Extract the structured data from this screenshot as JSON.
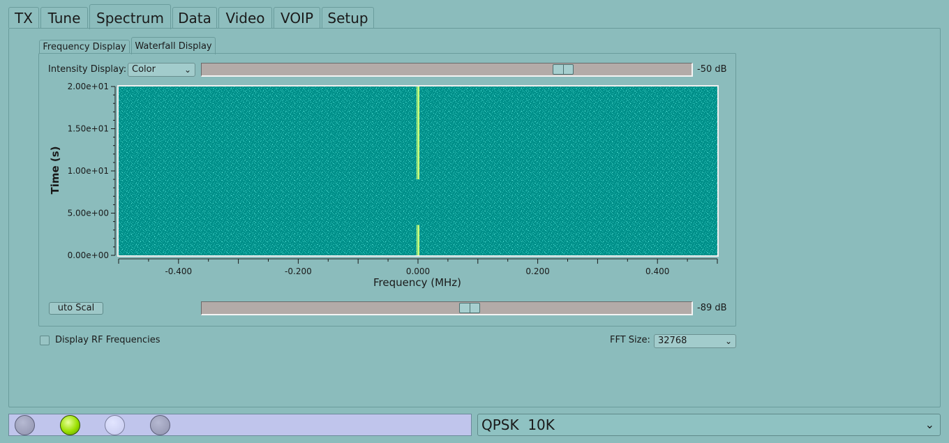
{
  "tabs": [
    "TX",
    "Tune",
    "Spectrum",
    "Data",
    "Video",
    "VOIP",
    "Setup"
  ],
  "active_tab": "Spectrum",
  "sub_tabs": [
    "Frequency Display",
    "Waterfall Display"
  ],
  "active_sub_tab": "Waterfall Display",
  "intensity": {
    "label": "Intensity Display:",
    "selected": "Color",
    "max_value": "-50 dB",
    "max_level": 0.75,
    "min_value": "-89 dB",
    "min_level": 0.55
  },
  "auto_scale_label": "uto Scal",
  "colors": {
    "waterfall_background": "#00908a",
    "waterfall_noise": "#2cc4bc",
    "signal": "#d4ff7a",
    "led_active": "#9ae000",
    "status_bar": "#c0c5ec"
  },
  "chart_data": {
    "type": "heatmap",
    "xlabel": "Frequency (MHz)",
    "ylabel": "Time (s)",
    "xlim": [
      -0.5,
      0.5
    ],
    "ylim": [
      0,
      20
    ],
    "x_ticks": [
      "-0.400",
      "-0.200",
      "0.000",
      "0.200",
      "0.400"
    ],
    "x_tick_values": [
      -0.4,
      -0.2,
      0.0,
      0.2,
      0.4
    ],
    "y_ticks": [
      "0.00e+00",
      "5.00e+00",
      "1.00e+01",
      "1.50e+01",
      "2.00e+01"
    ],
    "y_tick_values": [
      0,
      5,
      10,
      15,
      20
    ],
    "signal_frequency": 0.0,
    "signal_segments": [
      [
        0,
        3.6
      ],
      [
        9.0,
        20
      ]
    ]
  },
  "display_rf": {
    "label": "Display RF Frequencies",
    "checked": false
  },
  "fft": {
    "label": "FFT Size:",
    "selected": "32768"
  },
  "status_leds": [
    "inactive",
    "active",
    "idle",
    "inactive"
  ],
  "mode": {
    "selected": "QPSK  10K"
  }
}
